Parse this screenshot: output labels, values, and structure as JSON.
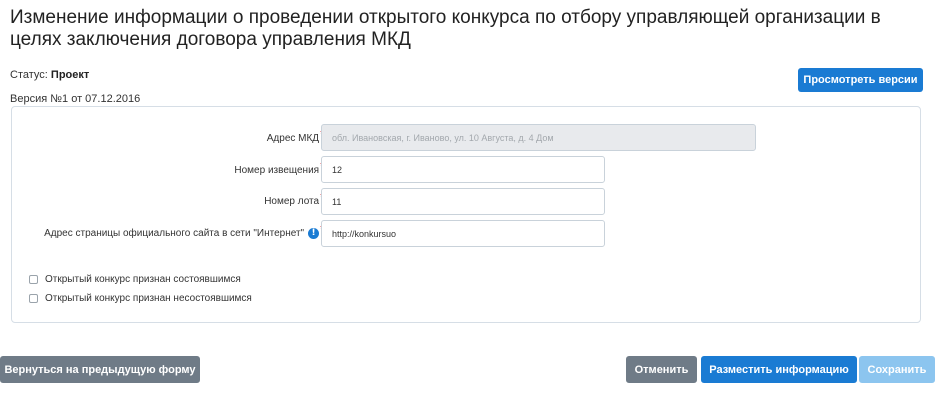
{
  "page": {
    "title": "Изменение информации о проведении открытого конкурса по отбору управляющей организации в целях заключения договора управления МКД"
  },
  "status": {
    "label": "Статус:",
    "value": "Проект"
  },
  "version": {
    "text": "Версия №1 от 07.12.2016"
  },
  "buttons": {
    "view_versions": "Просмотреть версии",
    "back": "Вернуться на предыдущую форму",
    "cancel": "Отменить",
    "publish": "Разместить информацию",
    "save": "Сохранить"
  },
  "form": {
    "address": {
      "label": "Адрес МКД",
      "required_mark": "*",
      "value": "обл. Ивановская, г. Иваново, ул. 10 Августа, д. 4 Дом"
    },
    "notice_number": {
      "label": "Номер извещения",
      "required_mark": "*",
      "value": "12"
    },
    "lot_number": {
      "label": "Номер лота",
      "required_mark": "*",
      "value": "11"
    },
    "website": {
      "label": "Адрес страницы официального сайта в сети \"Интернет\"",
      "info_glyph": "!",
      "required_mark": "*",
      "value": "http://konkursuo"
    },
    "checkboxes": [
      {
        "label": "Открытый конкурс признан состоявшимся",
        "checked": false
      },
      {
        "label": "Открытый конкурс признан несостоявшимся",
        "checked": false
      }
    ]
  },
  "colors": {
    "primary": "#1a7bd3",
    "secondary": "#6f7b87",
    "disabled": "#8cc5ef",
    "required": "#d9232b"
  }
}
